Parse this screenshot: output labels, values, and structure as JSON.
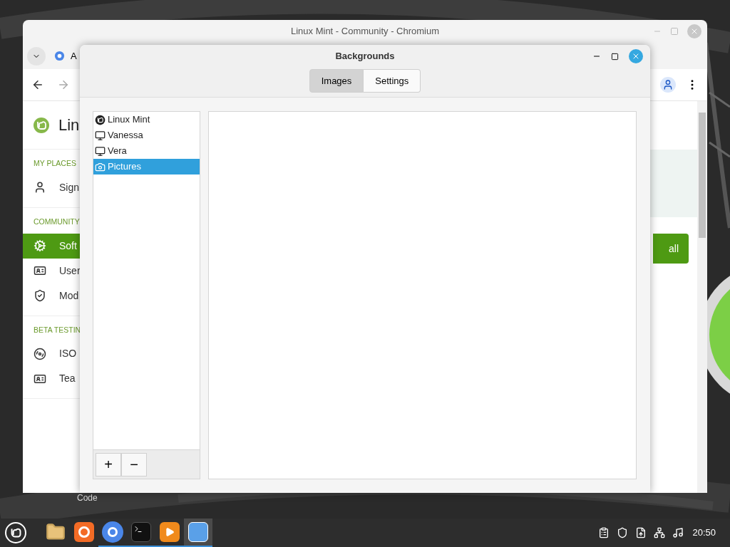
{
  "browser": {
    "title": "Linux Mint - Community - Chromium",
    "tab_title": "A",
    "logo_text": "Lin",
    "sections": [
      {
        "heading": "MY PLACES",
        "items": [
          {
            "label": "Sign",
            "selected": false
          }
        ]
      },
      {
        "heading": "COMMUNITY",
        "items": [
          {
            "label": "Soft",
            "selected": true
          },
          {
            "label": "User",
            "selected": false
          },
          {
            "label": "Mod",
            "selected": false
          }
        ]
      },
      {
        "heading": "BETA TESTIN",
        "items": [
          {
            "label": "ISO",
            "selected": false
          },
          {
            "label": "Tea",
            "selected": false
          }
        ]
      }
    ],
    "action_button": "all",
    "bottom_text": "Code"
  },
  "dialog": {
    "title": "Backgrounds",
    "tabs": [
      {
        "label": "Images",
        "selected": true
      },
      {
        "label": "Settings",
        "selected": false
      }
    ],
    "collections": [
      {
        "label": "Linux Mint",
        "kind": "distro",
        "selected": false
      },
      {
        "label": "Vanessa",
        "kind": "release",
        "selected": false
      },
      {
        "label": "Vera",
        "kind": "release",
        "selected": false
      },
      {
        "label": "Pictures",
        "kind": "folder",
        "selected": true
      }
    ],
    "buttons": [
      "+",
      "−"
    ]
  },
  "taskbar": {
    "apps": [
      {
        "kind": "files",
        "running": false,
        "active": false
      },
      {
        "kind": "firefox",
        "running": false,
        "active": false
      },
      {
        "kind": "chromium",
        "running": true,
        "active": false
      },
      {
        "kind": "terminal",
        "running": true,
        "active": false
      },
      {
        "kind": "player",
        "running": true,
        "active": false
      },
      {
        "kind": "backgrounds",
        "running": true,
        "active": true
      }
    ],
    "clock": "20:50"
  }
}
